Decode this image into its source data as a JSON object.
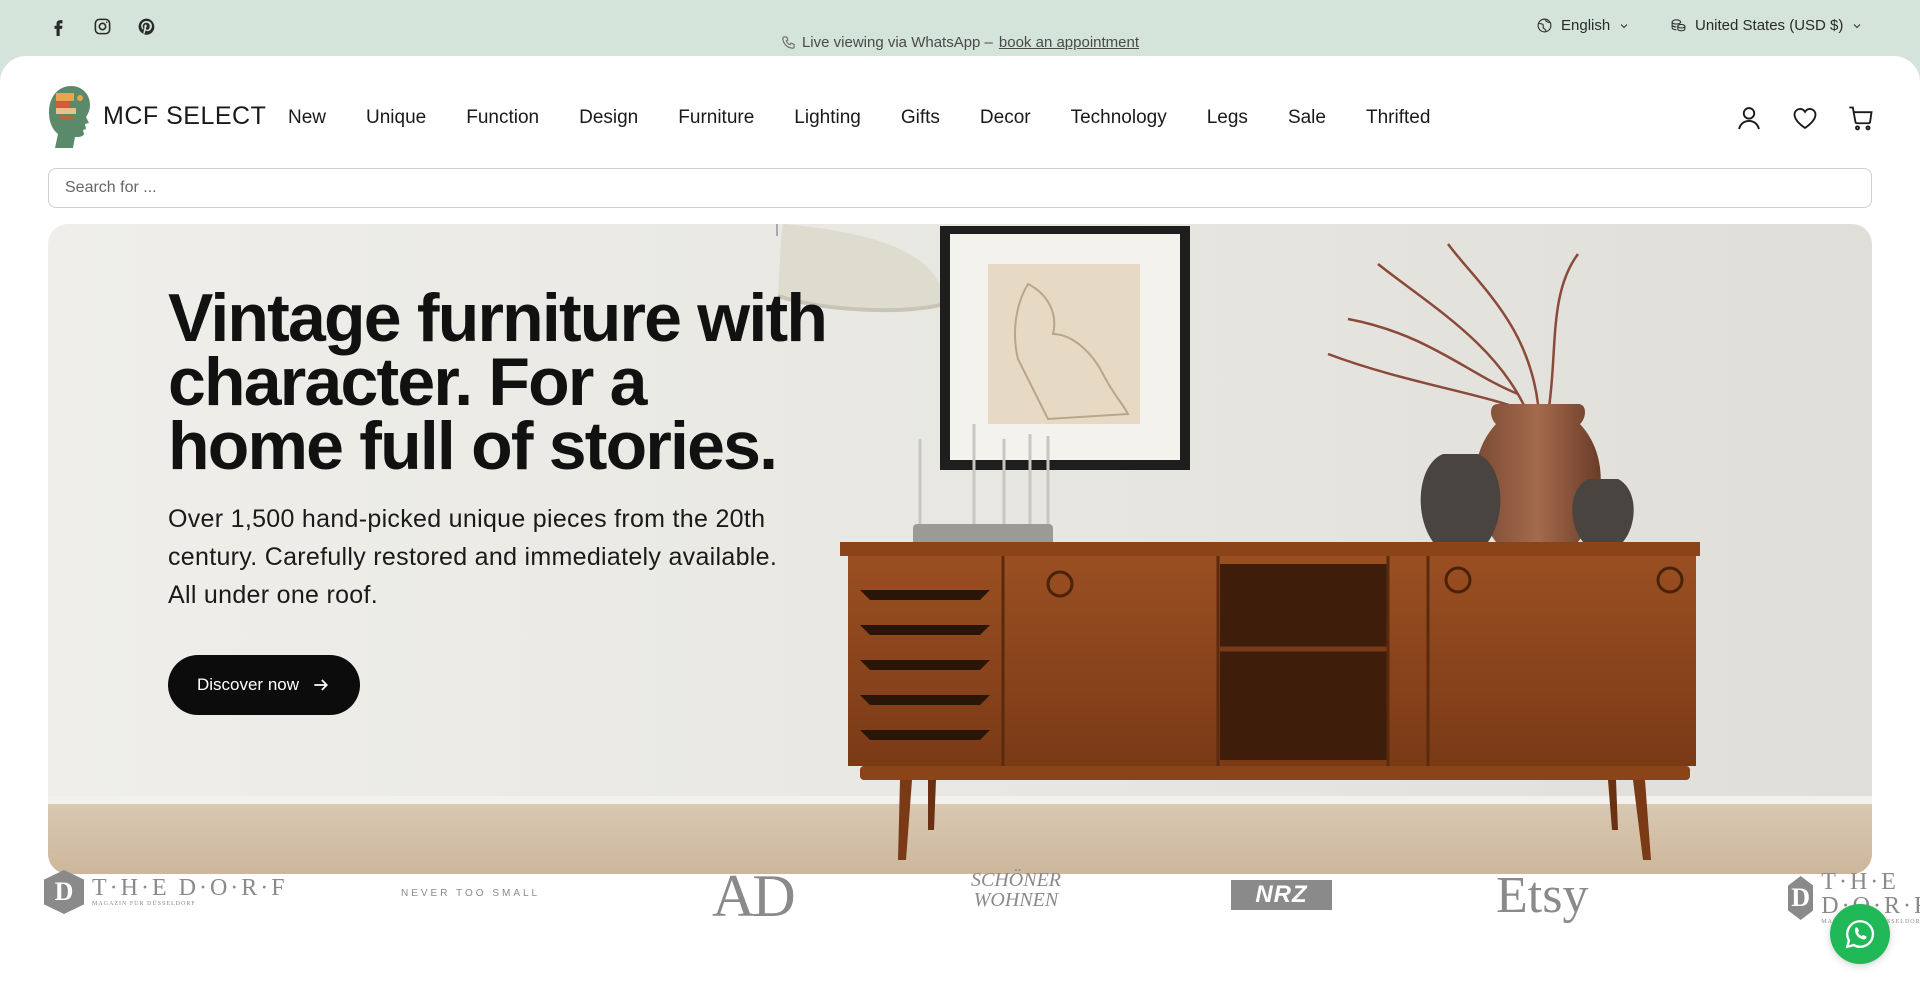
{
  "topbar": {
    "social": [
      {
        "icon": "facebook-icon"
      },
      {
        "icon": "instagram-icon"
      },
      {
        "icon": "pinterest-icon"
      }
    ],
    "announcement_text": "Live viewing via WhatsApp –",
    "announcement_link": "book an appointment",
    "language": "English",
    "currency": "United States (USD $)"
  },
  "header": {
    "logo_text": "MCF SELECT",
    "nav": [
      "New",
      "Unique",
      "Function",
      "Design",
      "Furniture",
      "Lighting",
      "Gifts",
      "Decor",
      "Technology",
      "Legs",
      "Sale",
      "Thrifted"
    ],
    "icons": [
      "account-icon",
      "wishlist-icon",
      "cart-icon"
    ]
  },
  "search": {
    "placeholder": "Search for ..."
  },
  "hero": {
    "title": "Vintage furniture with character. For a home full of stories.",
    "subtitle": "Over 1,500 hand-picked unique pieces from the 20th century. Carefully restored and immediately available. All under one roof.",
    "button_label": "Discover now"
  },
  "press": {
    "dorf_initial": "D",
    "dorf_name": "T·H·E D·O·R·F",
    "dorf_tagline": "MAGAZIN FÜR DÜSSELDORF",
    "nts": "NEVER TOO SMALL",
    "ad": "AD",
    "sw_line1": "SCHÖNER",
    "sw_line2": "WOHNEN",
    "nrz": "NRZ",
    "etsy": "Etsy"
  },
  "colors": {
    "topbar_bg": "#d4e4da",
    "button_bg": "#0c0c0c",
    "whatsapp": "#21b958"
  }
}
